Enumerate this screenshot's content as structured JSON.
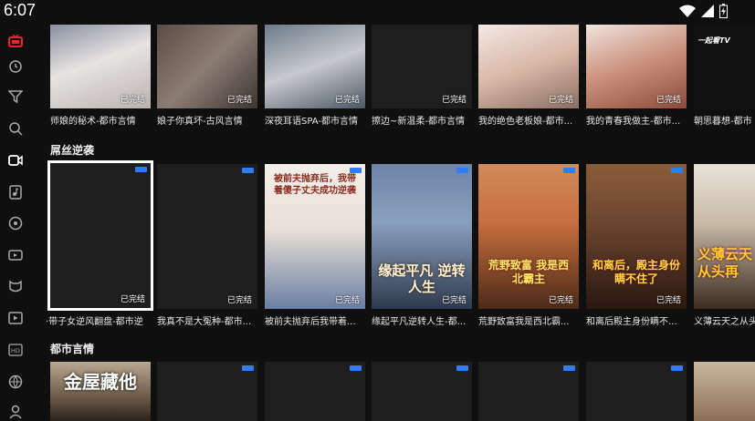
{
  "status_bar": {
    "time": "6:07"
  },
  "sidebar": {
    "items": [
      {
        "icon": "tv-icon",
        "active": true
      },
      {
        "icon": "history-icon"
      },
      {
        "icon": "filter-icon"
      },
      {
        "icon": "search-icon"
      },
      {
        "icon": "video-icon"
      },
      {
        "icon": "music-icon"
      },
      {
        "icon": "gamepad-icon"
      },
      {
        "icon": "live-tv-icon"
      },
      {
        "icon": "kids-icon"
      },
      {
        "icon": "movie-icon"
      },
      {
        "icon": "hd-icon"
      },
      {
        "icon": "sports-icon"
      },
      {
        "icon": "profile-icon"
      }
    ]
  },
  "rows": [
    {
      "title": "",
      "cards": [
        {
          "title": "师娘的秘术-都市言情",
          "status": "已完结"
        },
        {
          "title": "娘子你真坏-古风言情",
          "status": "已完结"
        },
        {
          "title": "深夜耳语SPA-都市言情",
          "status": "已完结"
        },
        {
          "title": "擦边~新温柔-都市言情",
          "status": "已完结"
        },
        {
          "title": "我的绝色老板娘-都市...",
          "status": "已完结"
        },
        {
          "title": "我的青春我做主-都市...",
          "status": "已完结"
        },
        {
          "title": "朝思暮想-都市",
          "status": "",
          "logo": "一起看TV"
        }
      ]
    },
    {
      "title": "屌丝逆袭",
      "cards": [
        {
          "title": "·带子女逆风翻盘-都市逆",
          "status": "已完结"
        },
        {
          "title": "我真不是大冤种-都市...",
          "status": "已完结"
        },
        {
          "title": "被前夫抛弃后我带着...",
          "status": "已完结",
          "poster_text": "被前夫抛弃后，我带着傻子丈夫成功逆袭"
        },
        {
          "title": "缘起平凡逆转人生-都...",
          "status": "已完结",
          "poster_text": "缘起平凡 逆转人生"
        },
        {
          "title": "荒野致富我是西北霸...",
          "status": "已完结",
          "poster_text": "荒野致富 我是西北霸主"
        },
        {
          "title": "和离后殿主身份瞒不...",
          "status": "已完结",
          "poster_text": "和离后，殿主身份瞒不住了"
        },
        {
          "title": "义薄云天之从头",
          "status": "",
          "poster_text": "义薄云天 从头再"
        }
      ]
    },
    {
      "title": "都市言情",
      "cards": [
        {
          "title": "",
          "status": "",
          "poster_text": "金屋藏他"
        },
        {
          "title": "",
          "status": ""
        },
        {
          "title": "",
          "status": ""
        },
        {
          "title": "",
          "status": ""
        },
        {
          "title": "",
          "status": ""
        },
        {
          "title": "",
          "status": ""
        },
        {
          "title": "",
          "status": ""
        }
      ]
    }
  ],
  "colors": {
    "background": "#0f0f0f",
    "accent": "#e8262d",
    "badge": "#2f7cf6"
  }
}
